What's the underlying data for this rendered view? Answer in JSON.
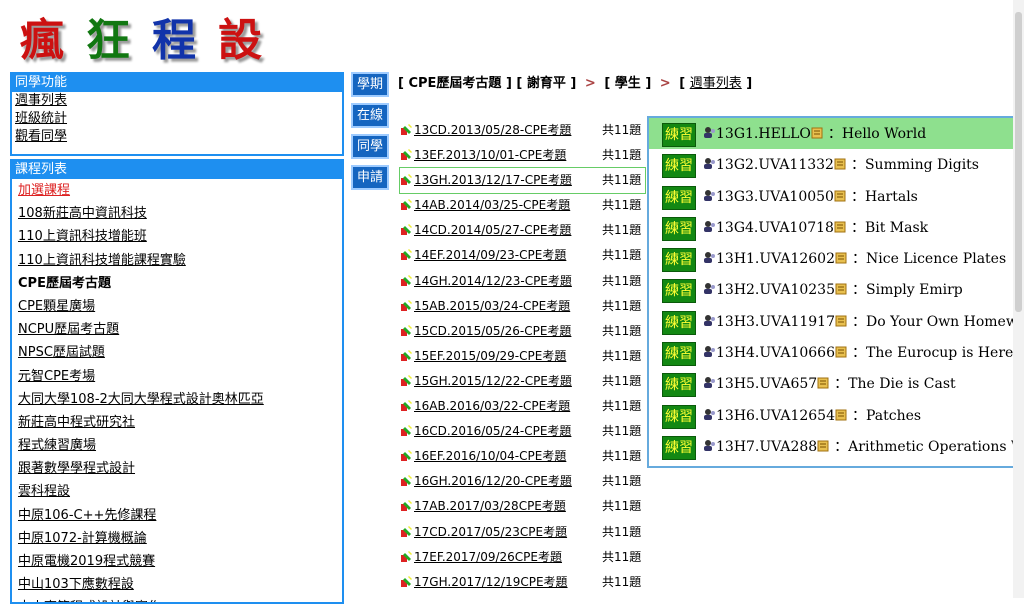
{
  "logo": {
    "chars": [
      "瘋",
      "狂",
      "程",
      "設"
    ]
  },
  "panel_class": {
    "title": "同學功能",
    "links": [
      "週事列表",
      "班級統計",
      "觀看同學"
    ]
  },
  "panel_courses": {
    "title": "課程列表",
    "items": [
      {
        "label": "加選課程",
        "style": "red"
      },
      {
        "label": "108新莊高中資訊科技",
        "style": ""
      },
      {
        "label": "110上資訊科技增能班",
        "style": ""
      },
      {
        "label": "110上資訊科技增能課程實驗",
        "style": ""
      },
      {
        "label": "CPE歷屆考古題",
        "style": "bold"
      },
      {
        "label": "CPE顆星廣場",
        "style": ""
      },
      {
        "label": "NCPU歷屆考古題",
        "style": ""
      },
      {
        "label": "NPSC歷屆試題",
        "style": ""
      },
      {
        "label": "元智CPE考場",
        "style": ""
      },
      {
        "label": "大同大學108-2大同大學程式設計奧林匹亞",
        "style": ""
      },
      {
        "label": "新莊高中程式研究社",
        "style": ""
      },
      {
        "label": "程式練習廣場",
        "style": ""
      },
      {
        "label": "跟著數學學程式設計",
        "style": ""
      },
      {
        "label": "雲科程設",
        "style": ""
      },
      {
        "label": "中原106-C++先修課程",
        "style": ""
      },
      {
        "label": "中原1072-計算機概論",
        "style": ""
      },
      {
        "label": "中原電機2019程式競賽",
        "style": ""
      },
      {
        "label": "中山103下應數程設",
        "style": ""
      },
      {
        "label": "中山高等程式設計與實作",
        "style": ""
      }
    ]
  },
  "side_buttons": [
    "學期",
    "在線",
    "同學",
    "申請"
  ],
  "breadcrumb": {
    "course": "[ CPE歷屆考古題 ]",
    "teacher": "[ 謝育平 ]",
    "role": "[ 學生 ]",
    "link_open": "[ ",
    "link": "週事列表",
    "link_close": " ]",
    "sep": ">"
  },
  "exams": [
    {
      "name": "13CD.2013/05/28-CPE考題",
      "count": "共11題"
    },
    {
      "name": "13EF.2013/10/01-CPE考題",
      "count": "共11題"
    },
    {
      "name": "13GH.2013/12/17-CPE考題",
      "count": "共11題",
      "selected": true
    },
    {
      "name": "14AB.2014/03/25-CPE考題",
      "count": "共11題"
    },
    {
      "name": "14CD.2014/05/27-CPE考題",
      "count": "共11題"
    },
    {
      "name": "14EF.2014/09/23-CPE考題",
      "count": "共11題"
    },
    {
      "name": "14GH.2014/12/23-CPE考題",
      "count": "共11題"
    },
    {
      "name": "15AB.2015/03/24-CPE考題",
      "count": "共11題"
    },
    {
      "name": "15CD.2015/05/26-CPE考題",
      "count": "共11題"
    },
    {
      "name": "15EF.2015/09/29-CPE考題",
      "count": "共11題"
    },
    {
      "name": "15GH.2015/12/22-CPE考題",
      "count": "共11題"
    },
    {
      "name": "16AB.2016/03/22-CPE考題",
      "count": "共11題"
    },
    {
      "name": "16CD.2016/05/24-CPE考題",
      "count": "共11題"
    },
    {
      "name": "16EF.2016/10/04-CPE考題",
      "count": "共11題"
    },
    {
      "name": "16GH.2016/12/20-CPE考題",
      "count": "共11題"
    },
    {
      "name": "17AB.2017/03/28CPE考題",
      "count": "共11題"
    },
    {
      "name": "17CD.2017/05/23CPE考題",
      "count": "共11題"
    },
    {
      "name": "17EF.2017/09/26CPE考題",
      "count": "共11題"
    },
    {
      "name": "17GH.2017/12/19CPE考題",
      "count": "共11題"
    }
  ],
  "practice": {
    "button_label": "練習",
    "sep": "：",
    "items": [
      {
        "code": "13G1.HELLO",
        "title": "Hello World",
        "highlight": true
      },
      {
        "code": "13G2.UVA11332",
        "title": "Summing Digits"
      },
      {
        "code": "13G3.UVA10050",
        "title": "Hartals"
      },
      {
        "code": "13G4.UVA10718",
        "title": "Bit Mask"
      },
      {
        "code": "13H1.UVA12602",
        "title": "Nice Licence Plates"
      },
      {
        "code": "13H2.UVA10235",
        "title": "Simply Emirp"
      },
      {
        "code": "13H3.UVA11917",
        "title": "Do Your Own Homework"
      },
      {
        "code": "13H4.UVA10666",
        "title": "The Eurocup is Here!"
      },
      {
        "code": "13H5.UVA657",
        "title": "The Die is Cast"
      },
      {
        "code": "13H6.UVA12654",
        "title": "Patches"
      },
      {
        "code": "13H7.UVA288",
        "title": "Arithmetic Operations With Large Integers"
      }
    ]
  },
  "colors": {
    "panel_border": "#1e8ff0",
    "button_bg": "#1565c0",
    "practice_btn_bg": "#138813",
    "practice_btn_text": "#ffff33",
    "highlight_row": "#8ee08e",
    "link_red": "#dd2222"
  },
  "icons": {
    "exam": "pencil-icon",
    "user": "user-icon",
    "edit": "edit-note-icon"
  }
}
